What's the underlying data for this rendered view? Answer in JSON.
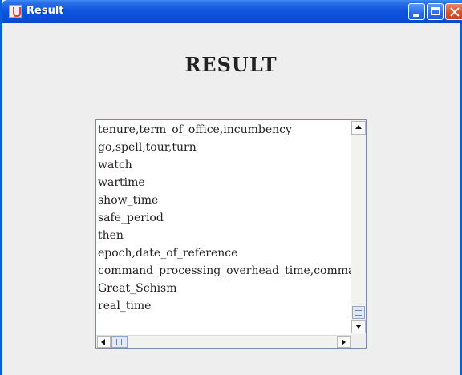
{
  "window": {
    "title": "Result",
    "app_icon": "java-cup-icon",
    "controls": [
      "minimize-icon",
      "maximize-icon",
      "close-icon"
    ]
  },
  "main": {
    "heading": "RESULT",
    "results": [
      "tenure,term_of_office,incumbency",
      "go,spell,tour,turn",
      "watch",
      "wartime",
      "show_time",
      "safe_period",
      "then",
      "epoch,date_of_reference",
      "command_processing_overhead_time,command_processing_time",
      "Great_Schism",
      "real_time"
    ]
  },
  "colors": {
    "titlebar": "#0b4ed7",
    "window_bg": "#eeeeee",
    "list_bg": "#ffffff",
    "close_button": "#d8532d"
  }
}
